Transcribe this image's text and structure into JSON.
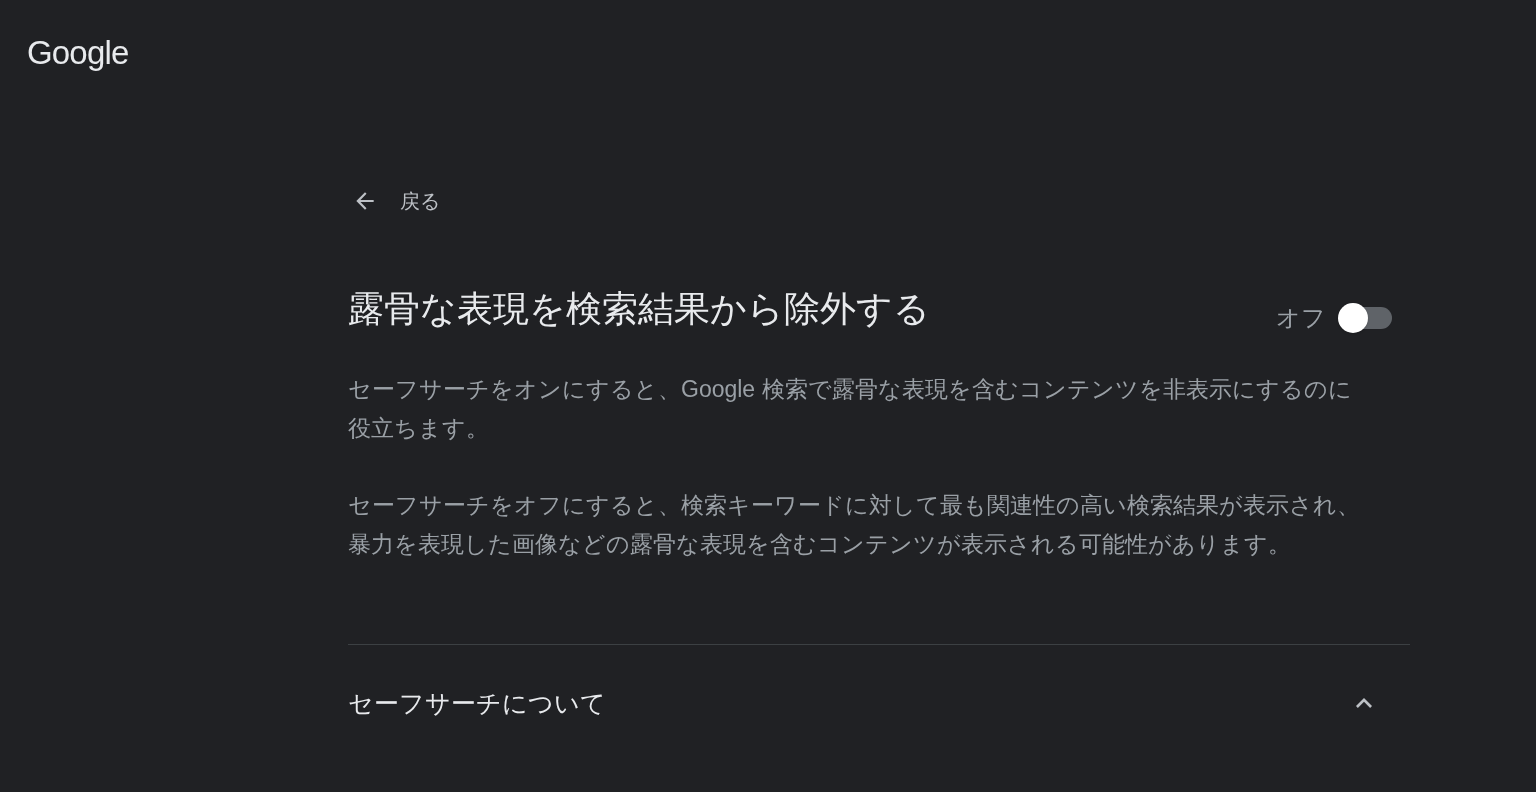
{
  "logo": "Google",
  "back": {
    "label": "戻る"
  },
  "setting": {
    "title": "露骨な表現を検索結果から除外する",
    "state_label": "オフ",
    "on": false
  },
  "paragraphs": [
    "セーフサーチをオンにすると、Google 検索で露骨な表現を含むコンテンツを非表示にするのに役立ちます。",
    "セーフサーチをオフにすると、検索キーワードに対して最も関連性の高い検索結果が表示され、暴力を表現した画像などの露骨な表現を含むコンテンツが表示される可能性があります。"
  ],
  "section": {
    "title": "セーフサーチについて",
    "expanded": true
  }
}
